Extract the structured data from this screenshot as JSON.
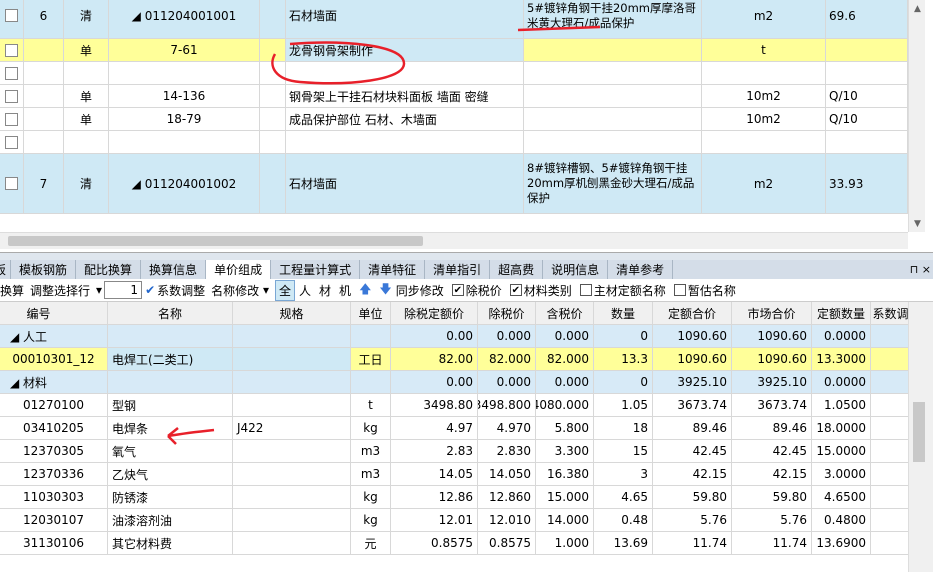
{
  "upper_grid": {
    "rows": [
      {
        "no": "6",
        "type": "清",
        "code": "◢ 011204001001",
        "name": "石材墙面",
        "spec": "5#镀锌角钢干挂20mm厚摩洛哥米黄大理石/成品保护",
        "unit": "m2",
        "qty": "69.6",
        "style": "blue"
      },
      {
        "no": "",
        "type": "单",
        "code": "7-61",
        "name": "龙骨钢骨架制作",
        "spec": "",
        "unit": "t",
        "qty": "",
        "style": "yellow"
      },
      {
        "no": "",
        "type": "",
        "code": "",
        "name": "",
        "spec": "",
        "unit": "",
        "qty": "",
        "style": "white"
      },
      {
        "no": "",
        "type": "单",
        "code": "14-136",
        "name": "钢骨架上干挂石材块料面板 墙面 密缝",
        "spec": "",
        "unit": "10m2",
        "qty": "Q/10",
        "style": "white"
      },
      {
        "no": "",
        "type": "单",
        "code": "18-79",
        "name": "成品保护部位 石材、木墙面",
        "spec": "",
        "unit": "10m2",
        "qty": "Q/10",
        "style": "white"
      },
      {
        "no": "",
        "type": "",
        "code": "",
        "name": "",
        "spec": "",
        "unit": "",
        "qty": "",
        "style": "white"
      },
      {
        "no": "7",
        "type": "清",
        "code": "◢ 011204001002",
        "name": "石材墙面",
        "spec": "8#镀锌槽钢、5#镀锌角钢干挂20mm厚机刨黑金砂大理石/成品保护",
        "unit": "m2",
        "qty": "33.93",
        "style": "blue"
      }
    ]
  },
  "tabs": [
    "板",
    "模板钢筋",
    "配比换算",
    "换算信息",
    "单价组成",
    "工程量计算式",
    "清单特征",
    "清单指引",
    "超高费",
    "说明信息",
    "清单参考"
  ],
  "selected_tab": 4,
  "pin_icons": "⊓  ×",
  "toolbar": {
    "t1": "换算",
    "t2": "调整选择行",
    "spin": "1",
    "t3": "系数调整",
    "t4": "名称修改",
    "filters": [
      "全",
      "人",
      "材",
      "机"
    ],
    "sync": "同步修改",
    "c1": "除税价",
    "c2": "材料类别",
    "c3": "主材定额名称",
    "c4": "暂估名称",
    "checked": [
      "✔",
      "✔",
      "",
      ""
    ]
  },
  "bottom_grid": {
    "headers": [
      "编号",
      "名称",
      "规格",
      "单位",
      "除税定额价",
      "除税价",
      "含税价",
      "数量",
      "定额合价",
      "市场合价",
      "定额数量",
      "系数调"
    ],
    "rows": [
      {
        "kind": "group",
        "code": "◢ 人工",
        "name": "",
        "spec": "",
        "unit": "",
        "p1": "0.00",
        "p2": "0.000",
        "p3": "0.000",
        "qty": "0",
        "s1": "1090.60",
        "s2": "1090.60",
        "dq": "0.0000"
      },
      {
        "kind": "sely",
        "code": "00010301_12",
        "name": "电焊工(二类工)",
        "spec": "",
        "unit": "工日",
        "p1": "82.00",
        "p2": "82.000",
        "p3": "82.000",
        "qty": "13.3",
        "s1": "1090.60",
        "s2": "1090.60",
        "dq": "13.3000"
      },
      {
        "kind": "group",
        "code": "◢ 材料",
        "name": "",
        "spec": "",
        "unit": "",
        "p1": "0.00",
        "p2": "0.000",
        "p3": "0.000",
        "qty": "0",
        "s1": "3925.10",
        "s2": "3925.10",
        "dq": "0.0000"
      },
      {
        "kind": "row",
        "code": "01270100",
        "name": "型钢",
        "spec": "",
        "unit": "t",
        "p1": "3498.80",
        "p2": "3498.800",
        "p3": "4080.000",
        "qty": "1.05",
        "s1": "3673.74",
        "s2": "3673.74",
        "dq": "1.0500"
      },
      {
        "kind": "row",
        "code": "03410205",
        "name": "电焊条",
        "spec": "J422",
        "unit": "kg",
        "p1": "4.97",
        "p2": "4.970",
        "p3": "5.800",
        "qty": "18",
        "s1": "89.46",
        "s2": "89.46",
        "dq": "18.0000"
      },
      {
        "kind": "row",
        "code": "12370305",
        "name": "氧气",
        "spec": "",
        "unit": "m3",
        "p1": "2.83",
        "p2": "2.830",
        "p3": "3.300",
        "qty": "15",
        "s1": "42.45",
        "s2": "42.45",
        "dq": "15.0000"
      },
      {
        "kind": "row",
        "code": "12370336",
        "name": "乙炔气",
        "spec": "",
        "unit": "m3",
        "p1": "14.05",
        "p2": "14.050",
        "p3": "16.380",
        "qty": "3",
        "s1": "42.15",
        "s2": "42.15",
        "dq": "3.0000"
      },
      {
        "kind": "row",
        "code": "11030303",
        "name": "防锈漆",
        "spec": "",
        "unit": "kg",
        "p1": "12.86",
        "p2": "12.860",
        "p3": "15.000",
        "qty": "4.65",
        "s1": "59.80",
        "s2": "59.80",
        "dq": "4.6500"
      },
      {
        "kind": "row",
        "code": "12030107",
        "name": "油漆溶剂油",
        "spec": "",
        "unit": "kg",
        "p1": "12.01",
        "p2": "12.010",
        "p3": "14.000",
        "qty": "0.48",
        "s1": "5.76",
        "s2": "5.76",
        "dq": "0.4800"
      },
      {
        "kind": "row",
        "code": "31130106",
        "name": "其它材料费",
        "spec": "",
        "unit": "元",
        "p1": "0.8575",
        "p2": "0.8575",
        "p3": "1.000",
        "qty": "13.69",
        "s1": "11.74",
        "s2": "11.74",
        "dq": "13.6900"
      }
    ]
  },
  "annotation_color": "#e8202a"
}
